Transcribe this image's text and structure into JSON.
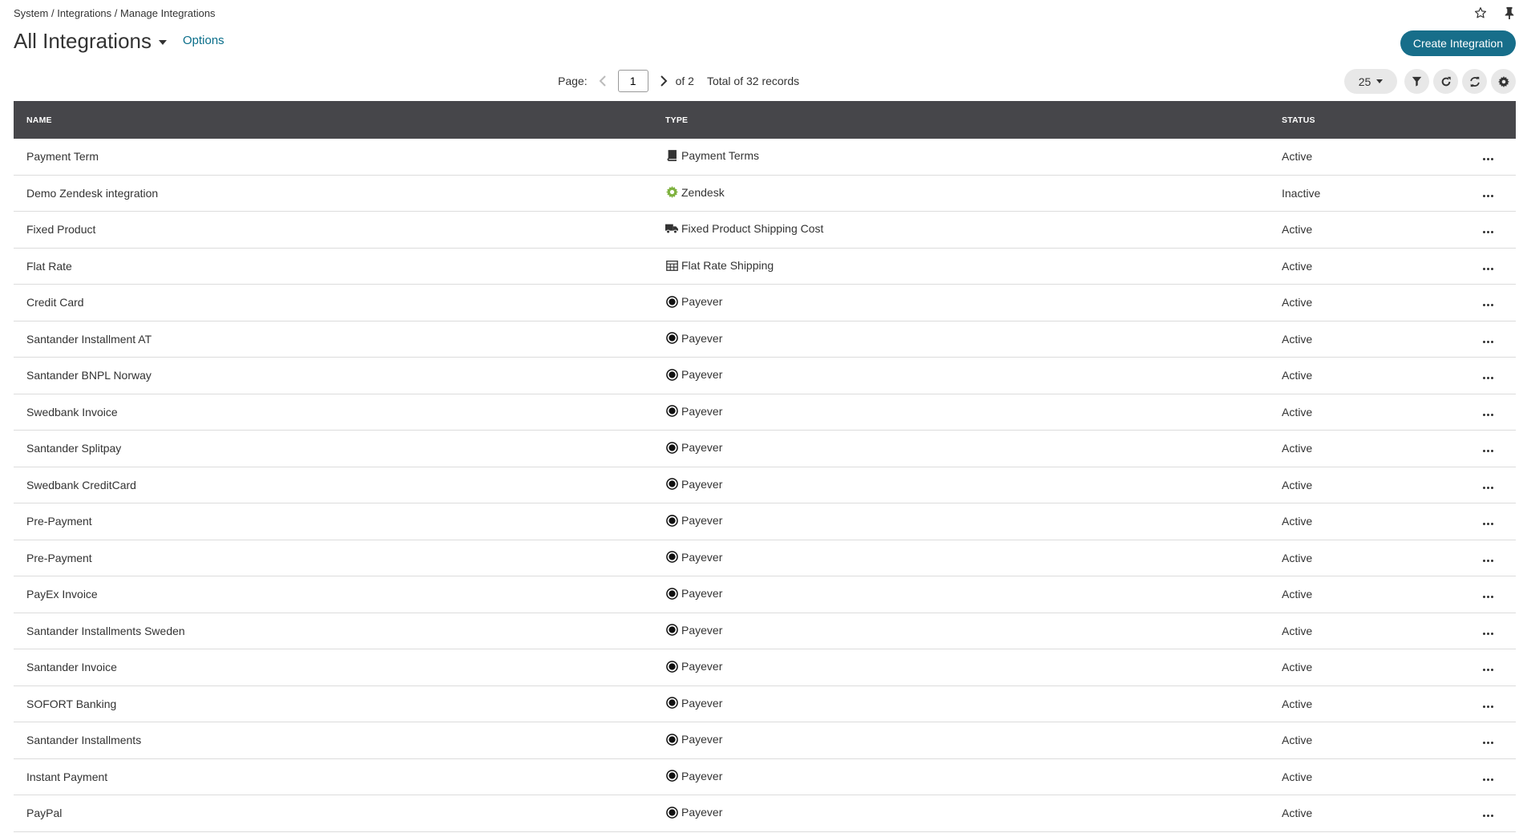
{
  "breadcrumb": {
    "items": [
      "System",
      "Integrations",
      "Manage Integrations"
    ],
    "separator": "/"
  },
  "header": {
    "title": "All Integrations",
    "options_label": "Options",
    "create_label": "Create Integration",
    "accent": "#176e8a"
  },
  "pager": {
    "page_label": "Page:",
    "current_page": "1",
    "of_text": "of 2",
    "total_text": "Total of 32 records",
    "per_page": "25"
  },
  "table": {
    "columns": {
      "name": "NAME",
      "type": "TYPE",
      "status": "STATUS"
    },
    "rows": [
      {
        "name": "Payment Term",
        "type": "Payment Terms",
        "icon": "book-icon",
        "status": "Active"
      },
      {
        "name": "Demo Zendesk integration",
        "type": "Zendesk",
        "icon": "gear-icon",
        "status": "Inactive"
      },
      {
        "name": "Fixed Product",
        "type": "Fixed Product Shipping Cost",
        "icon": "truck-icon",
        "status": "Active"
      },
      {
        "name": "Flat Rate",
        "type": "Flat Rate Shipping",
        "icon": "table-icon",
        "status": "Active"
      },
      {
        "name": "Credit Card",
        "type": "Payever",
        "icon": "payever-icon",
        "status": "Active"
      },
      {
        "name": "Santander Installment AT",
        "type": "Payever",
        "icon": "payever-icon",
        "status": "Active"
      },
      {
        "name": "Santander BNPL Norway",
        "type": "Payever",
        "icon": "payever-icon",
        "status": "Active"
      },
      {
        "name": "Swedbank Invoice",
        "type": "Payever",
        "icon": "payever-icon",
        "status": "Active"
      },
      {
        "name": "Santander Splitpay",
        "type": "Payever",
        "icon": "payever-icon",
        "status": "Active"
      },
      {
        "name": "Swedbank CreditCard",
        "type": "Payever",
        "icon": "payever-icon",
        "status": "Active"
      },
      {
        "name": "Pre-Payment",
        "type": "Payever",
        "icon": "payever-icon",
        "status": "Active"
      },
      {
        "name": "Pre-Payment",
        "type": "Payever",
        "icon": "payever-icon",
        "status": "Active"
      },
      {
        "name": "PayEx Invoice",
        "type": "Payever",
        "icon": "payever-icon",
        "status": "Active"
      },
      {
        "name": "Santander Installments Sweden",
        "type": "Payever",
        "icon": "payever-icon",
        "status": "Active"
      },
      {
        "name": "Santander Invoice",
        "type": "Payever",
        "icon": "payever-icon",
        "status": "Active"
      },
      {
        "name": "SOFORT Banking",
        "type": "Payever",
        "icon": "payever-icon",
        "status": "Active"
      },
      {
        "name": "Santander Installments",
        "type": "Payever",
        "icon": "payever-icon",
        "status": "Active"
      },
      {
        "name": "Instant Payment",
        "type": "Payever",
        "icon": "payever-icon",
        "status": "Active"
      },
      {
        "name": "PayPal",
        "type": "Payever",
        "icon": "payever-icon",
        "status": "Active"
      }
    ]
  },
  "colors": {
    "header_bg": "#46464a",
    "zendesk_icon": "#7fb240",
    "row_border": "#dcdcdc"
  }
}
